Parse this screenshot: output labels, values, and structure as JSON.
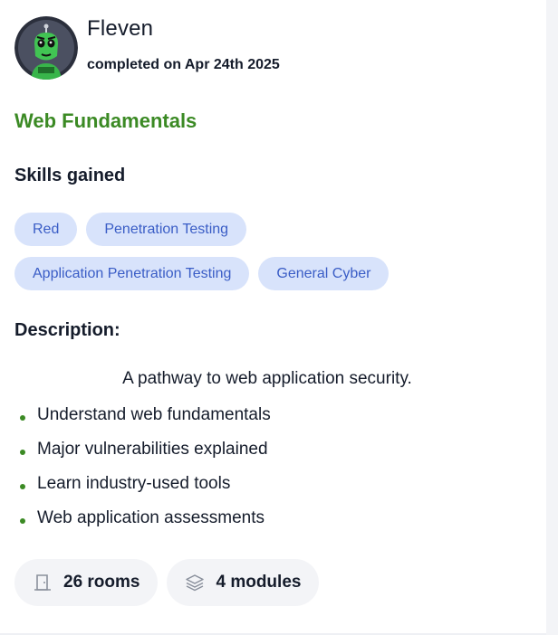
{
  "user": {
    "name": "Fleven",
    "completed_text": "completed on Apr 24th 2025"
  },
  "path": {
    "title": "Web Fundamentals"
  },
  "skills": {
    "heading": "Skills gained",
    "tags": [
      "Red",
      "Penetration Testing",
      "Application Penetration Testing",
      "General Cyber"
    ]
  },
  "description": {
    "heading": "Description:",
    "intro": "A pathway to web application security.",
    "bullets": [
      "Understand web fundamentals",
      "Major vulnerabilities explained",
      "Learn industry-used tools",
      "Web application assessments"
    ]
  },
  "stats": {
    "rooms": "26 rooms",
    "modules": "4 modules"
  },
  "colors": {
    "accent_green": "#3b8a24",
    "tag_bg": "#d8e3fb",
    "tag_text": "#3a5dc6",
    "stat_bg": "#f3f4f7"
  },
  "icons": {
    "rooms": "door-icon",
    "modules": "layers-icon"
  }
}
